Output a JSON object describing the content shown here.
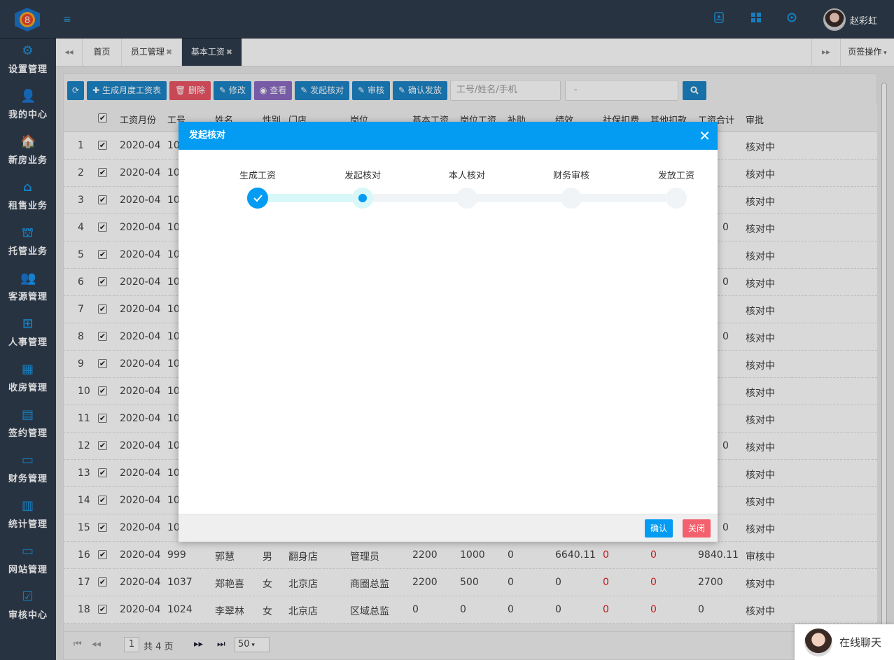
{
  "topbar": {
    "logo_text": "8",
    "user_name": "赵彩虹"
  },
  "sidebar": {
    "items": [
      {
        "label": "设置管理",
        "icon": "gear-icon"
      },
      {
        "label": "我的中心",
        "icon": "user-icon"
      },
      {
        "label": "新房业务",
        "icon": "house-icon"
      },
      {
        "label": "租售业务",
        "icon": "home-outline-icon"
      },
      {
        "label": "托管业务",
        "icon": "hand-house-icon"
      },
      {
        "label": "客源管理",
        "icon": "users-icon"
      },
      {
        "label": "人事管理",
        "icon": "org-chart-icon"
      },
      {
        "label": "收房管理",
        "icon": "building-icon"
      },
      {
        "label": "签约管理",
        "icon": "contract-icon"
      },
      {
        "label": "财务管理",
        "icon": "wallet-icon"
      },
      {
        "label": "统计管理",
        "icon": "bar-chart-icon"
      },
      {
        "label": "网站管理",
        "icon": "monitor-icon"
      },
      {
        "label": "审核中心",
        "icon": "check-doc-icon"
      }
    ]
  },
  "tabs": {
    "home": "首页",
    "employee": "员工管理",
    "salary": "基本工资",
    "page_ops": "页签操作"
  },
  "toolbar": {
    "refresh": "⟳",
    "generate": "生成月度工资表",
    "delete": "删除",
    "edit": "修改",
    "view": "查看",
    "start_check": "发起核对",
    "audit": "审核",
    "confirm_pay": "确认发放",
    "search_placeholder": "工号/姓名/手机",
    "range_value": "-"
  },
  "table": {
    "headers": {
      "month": "工资月份",
      "id": "工号",
      "name": "姓名",
      "gender": "性别",
      "store": "门店",
      "post": "岗位",
      "base": "基本工资",
      "post_salary": "岗位工资",
      "subsidy": "补助",
      "perf": "绩效",
      "social": "社保扣费",
      "other": "其他扣款",
      "total": "工资合计",
      "approve": "审批"
    },
    "rows": [
      {
        "no": "1",
        "month": "2020-04",
        "id": "10",
        "approve": "核对中"
      },
      {
        "no": "2",
        "month": "2020-04",
        "id": "10",
        "approve": "核对中"
      },
      {
        "no": "3",
        "month": "2020-04",
        "id": "10",
        "approve": "核对中"
      },
      {
        "no": "4",
        "month": "2020-04",
        "id": "10",
        "approve": "核对中"
      },
      {
        "no": "5",
        "month": "2020-04",
        "id": "10",
        "approve": "核对中"
      },
      {
        "no": "6",
        "month": "2020-04",
        "id": "10",
        "approve": "核对中"
      },
      {
        "no": "7",
        "month": "2020-04",
        "id": "10",
        "approve": "核对中"
      },
      {
        "no": "8",
        "month": "2020-04",
        "id": "10",
        "approve": "核对中"
      },
      {
        "no": "9",
        "month": "2020-04",
        "id": "10",
        "approve": "核对中"
      },
      {
        "no": "10",
        "month": "2020-04",
        "id": "10",
        "approve": "核对中"
      },
      {
        "no": "11",
        "month": "2020-04",
        "id": "10",
        "approve": "核对中"
      },
      {
        "no": "12",
        "month": "2020-04",
        "id": "10",
        "approve": "核对中"
      },
      {
        "no": "13",
        "month": "2020-04",
        "id": "10",
        "approve": "核对中"
      },
      {
        "no": "14",
        "month": "2020-04",
        "id": "10",
        "approve": "核对中"
      },
      {
        "no": "15",
        "month": "2020-04",
        "id": "10",
        "approve": "核对中"
      },
      {
        "no": "16",
        "month": "2020-04",
        "id": "999",
        "name": "郭慧",
        "gender": "男",
        "store": "翻身店",
        "post": "管理员",
        "base": "2200",
        "post_salary": "1000",
        "subsidy": "0",
        "perf": "6640.11",
        "social": "0",
        "other": "0",
        "total": "9840.11",
        "approve": "审核中"
      },
      {
        "no": "17",
        "month": "2020-04",
        "id": "1037",
        "name": "郑艳喜",
        "gender": "女",
        "store": "北京店",
        "post": "商圈总监",
        "base": "2200",
        "post_salary": "500",
        "subsidy": "0",
        "perf": "0",
        "social": "0",
        "other": "0",
        "total": "2700",
        "approve": "核对中"
      },
      {
        "no": "18",
        "month": "2020-04",
        "id": "1024",
        "name": "李翠林",
        "gender": "女",
        "store": "北京店",
        "post": "区域总监",
        "base": "0",
        "post_salary": "0",
        "subsidy": "0",
        "perf": "0",
        "social": "0",
        "other": "0",
        "total": "0",
        "approve": "核对中"
      }
    ],
    "partial_totals": {
      "r4": "0",
      "r6": "0",
      "r8": "0",
      "r12": "0",
      "r15": "0"
    }
  },
  "pager": {
    "page": "1",
    "of_pages": "共 4 页",
    "page_size": "50"
  },
  "modal": {
    "title": "发起核对",
    "close": "✕",
    "steps": [
      "生成工资",
      "发起核对",
      "本人核对",
      "财务审核",
      "发放工资"
    ],
    "current_step": 2,
    "confirm": "确认",
    "cancel": "关闭"
  },
  "chat": {
    "label": "在线聊天"
  },
  "colors": {
    "nav_bg": "#2f3d4e",
    "accent": "#039cf2",
    "danger": "#ed5565",
    "purple": "#8c6bc4"
  }
}
